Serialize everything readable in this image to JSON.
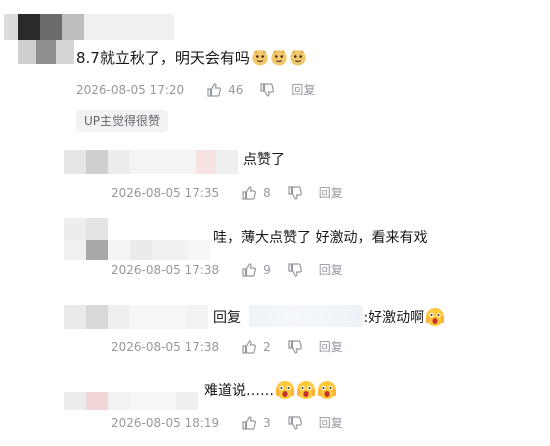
{
  "main_comment": {
    "text": "8.7就立秋了，明天会有吗",
    "emoji": [
      "doge-emoji",
      "doge-emoji",
      "doge-emoji"
    ],
    "time": "2026-08-05 17:20",
    "likes": "46",
    "reply_label": "回复",
    "badge": "UP主觉得很赞"
  },
  "replies": [
    {
      "text": "点赞了",
      "time": "2026-08-05 17:35",
      "likes": "8",
      "reply_label": "回复"
    },
    {
      "text": "哇，薄大点赞了 好激动，看来有戏",
      "time": "2026-08-05 17:38",
      "likes": "9",
      "reply_label": "回复"
    },
    {
      "reply_prefix": "回复",
      "text": ":好激动啊",
      "time": "2026-08-05 17:38",
      "likes": "2",
      "reply_label": "回复",
      "emoji": [
        "shocked-emoji"
      ]
    },
    {
      "text": "难道说……",
      "time": "2026-08-05 18:19",
      "likes": "3",
      "reply_label": "回复",
      "emoji": [
        "shocked-emoji",
        "shocked-emoji",
        "shocked-emoji"
      ]
    }
  ],
  "colors": {
    "text": "#18191c",
    "meta": "#9499a0",
    "badge_bg": "#f1f2f3",
    "badge_text": "#61666d"
  }
}
